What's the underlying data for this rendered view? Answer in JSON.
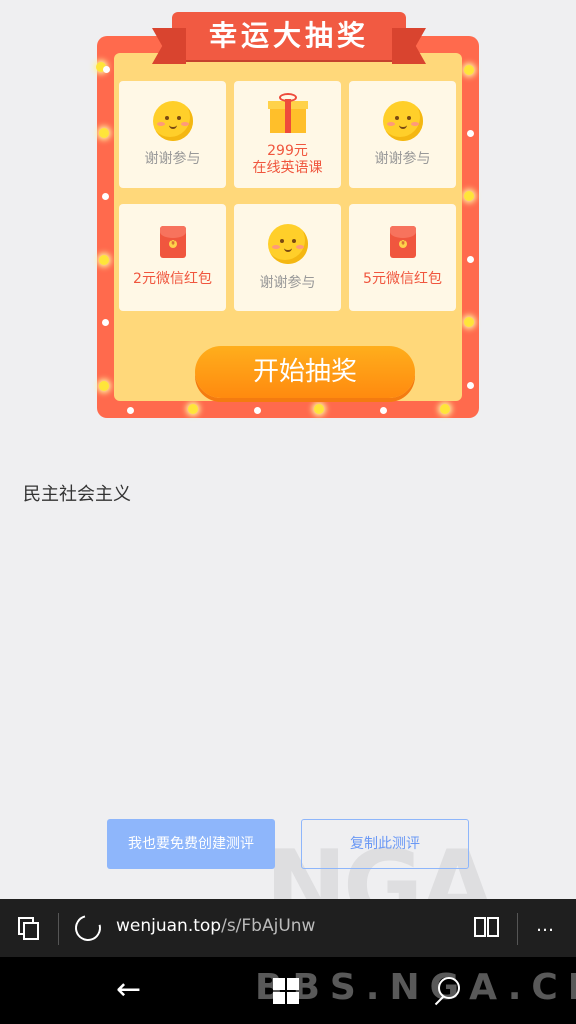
{
  "lottery": {
    "title": "幸运大抽奖",
    "cells": [
      {
        "icon": "smiley-icon",
        "text": "谢谢参与"
      },
      {
        "icon": "gift-icon",
        "line1": "299元",
        "line2": "在线英语课"
      },
      {
        "icon": "smiley-icon",
        "text": "谢谢参与"
      },
      {
        "icon": "red-envelope-icon",
        "text": "2元微信红包"
      },
      {
        "icon": "smiley-icon",
        "text": "谢谢参与"
      },
      {
        "icon": "red-envelope-icon",
        "text": "5元微信红包"
      }
    ],
    "start_label": "开始抽奖",
    "colors": {
      "frame": "#ff6a4d",
      "inner": "#ffd87a",
      "button": "#ff9a14"
    }
  },
  "question": {
    "text": "民主社会主义"
  },
  "actions": {
    "create_label": "我也要免费创建测评",
    "copy_label": "复制此测评",
    "accent": "#8eb6fb"
  },
  "watermark": {
    "text": "NGA",
    "site": "BBS.NGA.CN"
  },
  "browser": {
    "url_host": "wenjuan.top",
    "url_path": "/s/FbAjUnw",
    "more": "…"
  }
}
